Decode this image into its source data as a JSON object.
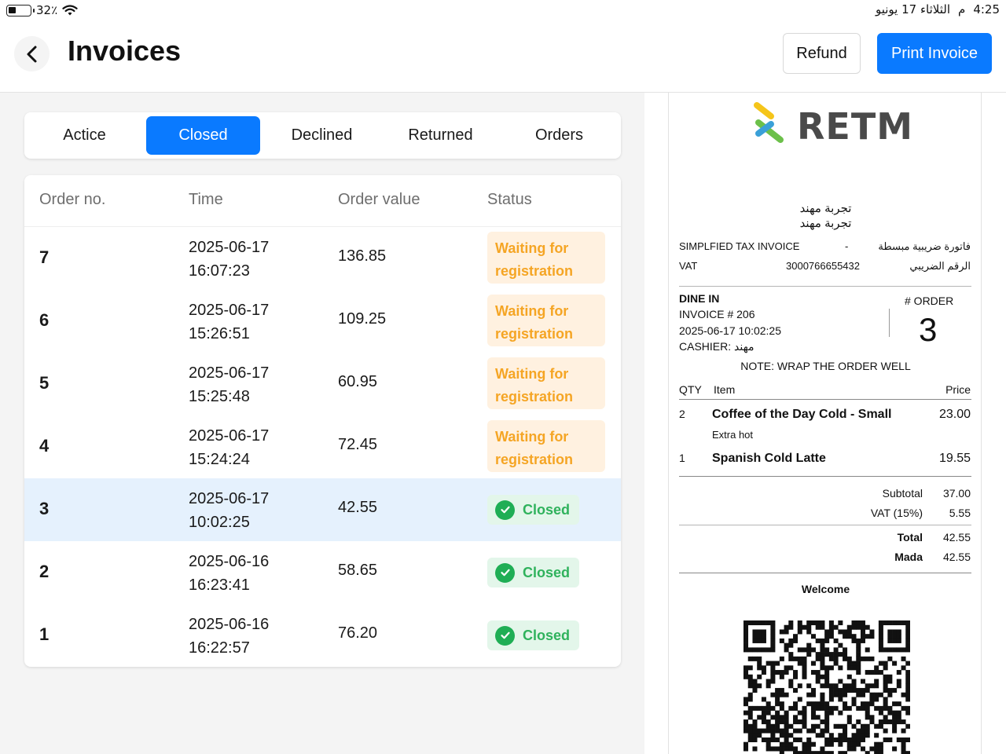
{
  "status_bar": {
    "battery": "32٪",
    "time": "4:25",
    "ampm": "م",
    "date": "الثلاثاء 17 يونيو"
  },
  "header": {
    "title": "Invoices",
    "refund_label": "Refund",
    "print_label": "Print Invoice"
  },
  "tabs": [
    {
      "label": "Actice",
      "active": false
    },
    {
      "label": "Closed",
      "active": true
    },
    {
      "label": "Declined",
      "active": false
    },
    {
      "label": "Returned",
      "active": false
    },
    {
      "label": "Orders",
      "active": false
    }
  ],
  "table": {
    "columns": [
      "Order no.",
      "Time",
      "Order value",
      "Status"
    ],
    "rows": [
      {
        "order": "7",
        "date": "2025-06-17",
        "time": "16:07:23",
        "value": "136.85",
        "status": "Waiting for registration",
        "status_type": "waiting"
      },
      {
        "order": "6",
        "date": "2025-06-17",
        "time": "15:26:51",
        "value": "109.25",
        "status": "Waiting for registration",
        "status_type": "waiting"
      },
      {
        "order": "5",
        "date": "2025-06-17",
        "time": "15:25:48",
        "value": "60.95",
        "status": "Waiting for registration",
        "status_type": "waiting"
      },
      {
        "order": "4",
        "date": "2025-06-17",
        "time": "15:24:24",
        "value": "72.45",
        "status": "Waiting for registration",
        "status_type": "waiting"
      },
      {
        "order": "3",
        "date": "2025-06-17",
        "time": "10:02:25",
        "value": "42.55",
        "status": "Closed",
        "status_type": "closed",
        "selected": true
      },
      {
        "order": "2",
        "date": "2025-06-16",
        "time": "16:23:41",
        "value": "58.65",
        "status": "Closed",
        "status_type": "closed"
      },
      {
        "order": "1",
        "date": "2025-06-16",
        "time": "16:22:57",
        "value": "76.20",
        "status": "Closed",
        "status_type": "closed"
      }
    ]
  },
  "receipt": {
    "logo": "RETM",
    "store_name_1": "تجربة مهند",
    "store_name_2": "تجربة مهند",
    "invoice_type_en": "SIMPLFIED TAX INVOICE",
    "invoice_type_sep": "-",
    "invoice_type_ar": "فاتورة ضريبية مبسطة",
    "vat_label_en": "VAT",
    "vat_number": "3000766655432",
    "vat_label_ar": "الرقم الضريبي",
    "service_type": "DINE IN",
    "invoice_no": "INVOICE # 206",
    "datetime": "2025-06-17 10:02:25",
    "cashier": "CASHIER: مهند",
    "order_label": "# ORDER",
    "order_number": "3",
    "note": "NOTE: WRAP THE ORDER WELL",
    "items_header": {
      "qty": "QTY",
      "item": "Item",
      "price": "Price"
    },
    "items": [
      {
        "qty": "2",
        "name": "Coffee of the Day Cold - Small",
        "modifier": "Extra hot",
        "price": "23.00"
      },
      {
        "qty": "1",
        "name": "Spanish Cold Latte",
        "modifier": "",
        "price": "19.55"
      }
    ],
    "subtotal_label": "Subtotal",
    "subtotal": "37.00",
    "vat_line_label": "VAT (15%)",
    "vat_amount": "5.55",
    "total_label": "Total",
    "total": "42.55",
    "payment_label": "Mada",
    "payment_amount": "42.55",
    "welcome": "Welcome"
  },
  "colors": {
    "accent": "#0a7aff",
    "waiting_bg": "#fff1e0",
    "waiting_text": "#f5a524",
    "closed_bg": "#e3f6ea",
    "closed_text": "#2fb25c",
    "selected_row": "#e5f1fd"
  },
  "icons": [
    "back-chevron-icon",
    "battery-icon",
    "wifi-icon",
    "check-circle-icon",
    "retm-logo-icon",
    "qr-code-icon"
  ]
}
